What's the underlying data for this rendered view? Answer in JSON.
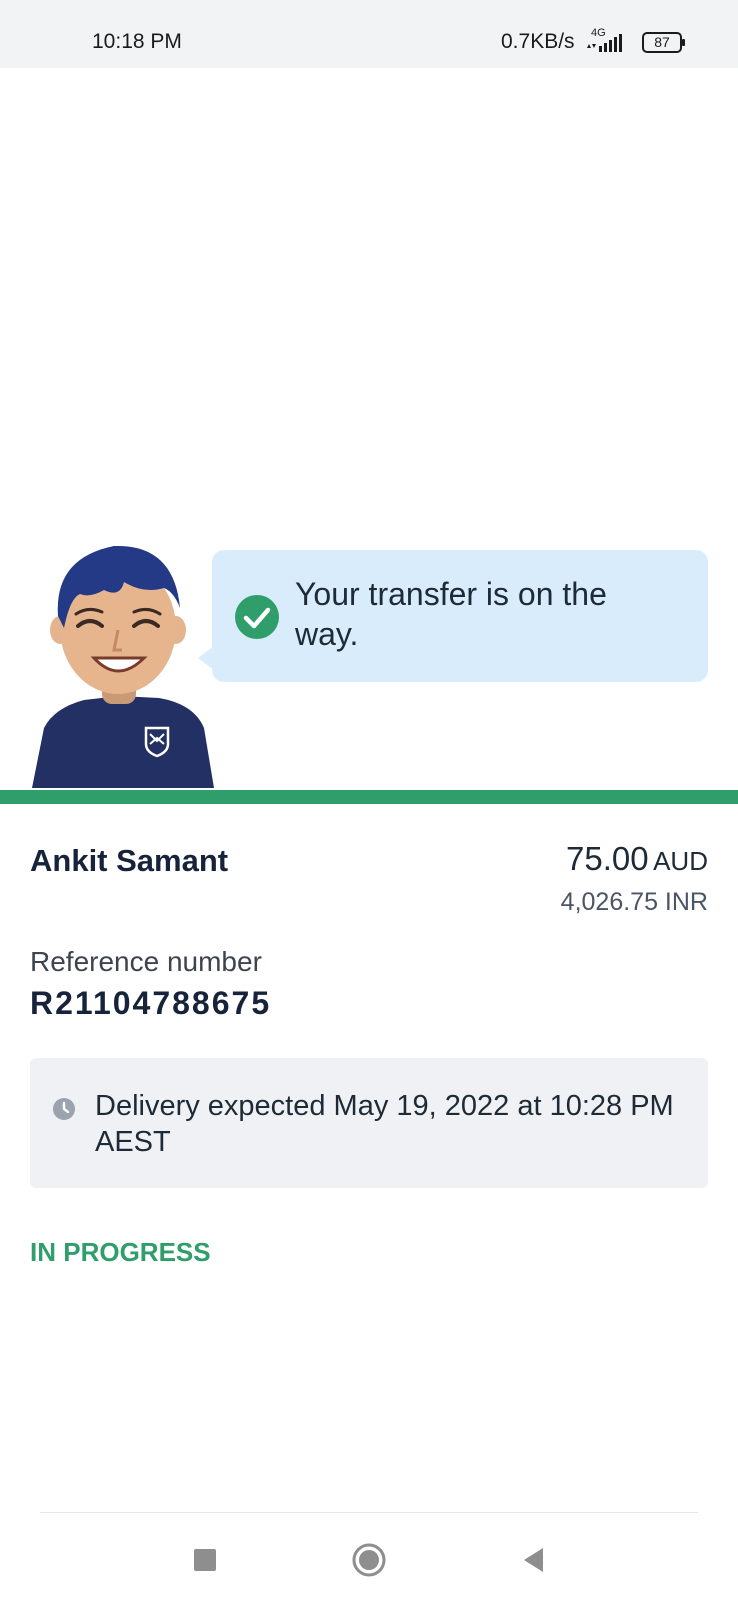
{
  "status_bar": {
    "time": "10:18 PM",
    "network_speed": "0.7KB/s",
    "network_type": "4G",
    "battery": "87"
  },
  "message": {
    "text": "Your transfer is on the way.",
    "icon": "check-circle-icon"
  },
  "transfer": {
    "recipient": "Ankit Samant",
    "amount": "75.00",
    "currency": "AUD",
    "converted_amount": "4,026.75 INR",
    "reference_label": "Reference number",
    "reference_number": "R21104788675",
    "delivery_text": "Delivery expected May 19, 2022 at 10:28 PM AEST",
    "status": "IN PROGRESS"
  },
  "colors": {
    "accent_green": "#2f9e6a",
    "bubble_blue": "#d8ecfb",
    "navy": "#233063"
  },
  "nav": {
    "recent": "square-icon",
    "home": "circle-icon",
    "back": "triangle-back-icon"
  }
}
